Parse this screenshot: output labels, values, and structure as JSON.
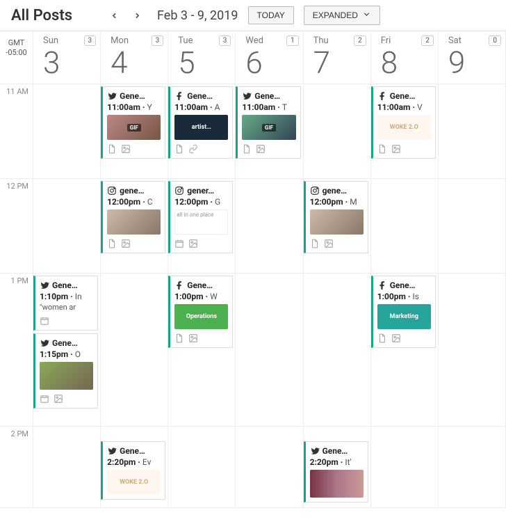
{
  "header": {
    "title": "All Posts",
    "dateRange": "Feb 3 - 9, 2019",
    "todayBtn": "TODAY",
    "viewBtn": "EXPANDED"
  },
  "tz": {
    "label": "GMT",
    "offset": "-05:00"
  },
  "days": [
    {
      "label": "Sun",
      "num": "3",
      "count": "3"
    },
    {
      "label": "Mon",
      "num": "4",
      "count": "3"
    },
    {
      "label": "Tue",
      "num": "5",
      "count": "3"
    },
    {
      "label": "Wed",
      "num": "6",
      "count": "1"
    },
    {
      "label": "Thu",
      "num": "7",
      "count": "2"
    },
    {
      "label": "Fri",
      "num": "8",
      "count": "2"
    },
    {
      "label": "Sat",
      "num": "9",
      "count": "0"
    }
  ],
  "hours": [
    "11 AM",
    "12 PM",
    "1 PM",
    "2 PM"
  ],
  "posts": {
    "mon11": {
      "net": "tw",
      "name": "Gene…",
      "time": "11:00am",
      "snip": "Y",
      "thumbLabel": "GIF"
    },
    "tue11": {
      "net": "fb",
      "name": "Gene…",
      "time": "11:00am",
      "snip": "A",
      "thumbLabel": "artist…"
    },
    "wed11": {
      "net": "tw",
      "name": "Gene…",
      "time": "11:00am",
      "snip": "T",
      "thumbLabel": "GIF"
    },
    "fri11": {
      "net": "fb",
      "name": "Gene…",
      "time": "11:00am",
      "snip": "V",
      "thumbLabel": "WOKE 2.O"
    },
    "mon12": {
      "net": "ig",
      "name": "gene…",
      "time": "12:00pm",
      "snip": "C"
    },
    "tue12": {
      "net": "ig",
      "name": "gener…",
      "time": "12:00pm",
      "snip": "G",
      "thumbLabel": "all in one place"
    },
    "thu12": {
      "net": "ig",
      "name": "gene…",
      "time": "12:00pm",
      "snip": "M"
    },
    "sun13a": {
      "net": "tw",
      "name": "Gene…",
      "time": "1:10pm",
      "snip": "In",
      "body": "\"women ar"
    },
    "sun13b": {
      "net": "tw",
      "name": "Gene…",
      "time": "1:15pm",
      "snip": "O"
    },
    "tue13": {
      "net": "fb",
      "name": "Gene…",
      "time": "1:00pm",
      "snip": "W",
      "thumbLabel": "Operations"
    },
    "fri13": {
      "net": "fb",
      "name": "Gene…",
      "time": "1:00pm",
      "snip": "Is",
      "thumbLabel": "Marketing"
    },
    "mon14": {
      "net": "tw",
      "name": "Gene…",
      "time": "2:20pm",
      "snip": "Ev",
      "thumbLabel": "WOKE 2.O"
    },
    "thu14": {
      "net": "tw",
      "name": "Gene…",
      "time": "2:20pm",
      "snip": "It'"
    }
  }
}
